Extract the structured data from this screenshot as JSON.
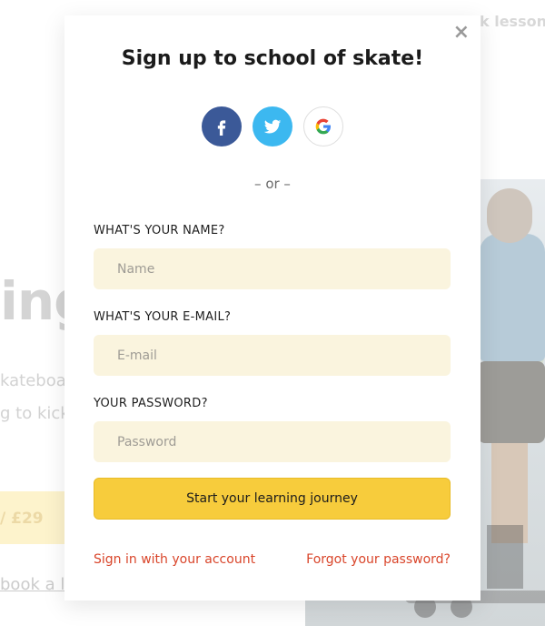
{
  "background": {
    "nav_fragment": "k lesson",
    "heading_fragment": "ing",
    "text_line1": "kateboar",
    "text_line2": "g to kick",
    "price_fragment": "/ £29",
    "link_fragment": "book a le"
  },
  "modal": {
    "close_label": "×",
    "title": "Sign up to school of skate!",
    "socials": [
      {
        "name": "facebook",
        "icon": "facebook-icon",
        "color": "#3b5998"
      },
      {
        "name": "twitter",
        "icon": "twitter-icon",
        "color": "#3cb8f0"
      },
      {
        "name": "google",
        "icon": "google-icon",
        "color": "#ffffff"
      }
    ],
    "divider": "– or –",
    "fields": {
      "name": {
        "label": "WHAT'S YOUR NAME?",
        "placeholder": "Name",
        "value": ""
      },
      "email": {
        "label": "WHAT'S YOUR E-MAIL?",
        "placeholder": "E-mail",
        "value": ""
      },
      "password": {
        "label": "YOUR PASSWORD?",
        "placeholder": "Password",
        "value": ""
      }
    },
    "cta_label": "Start your learning journey",
    "signin_link": "Sign in with your account",
    "forgot_link": "Forgot your password?"
  },
  "colors": {
    "accent": "#f7cc3c",
    "input_bg": "#faf4de",
    "link": "#d9452a"
  }
}
